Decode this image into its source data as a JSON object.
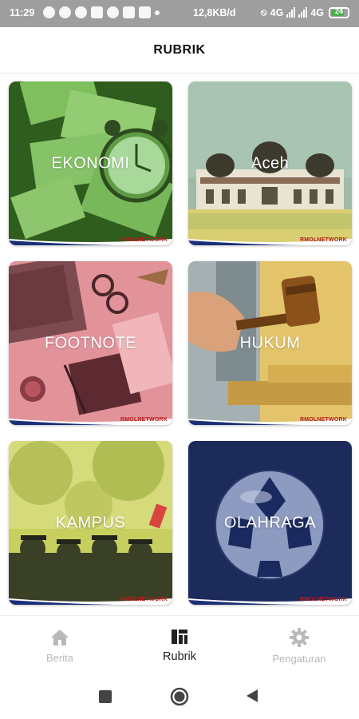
{
  "status_bar": {
    "time": "11:29",
    "network_speed": "12,8KB/d",
    "net_label_1": "4G",
    "net_label_2": "4G",
    "battery": "24"
  },
  "header": {
    "title": "RUBRIK"
  },
  "categories": [
    {
      "label": "EKONOMI",
      "brand": "RMOLNETWORK",
      "tint": "#7fbf5e"
    },
    {
      "label": "Aceh",
      "brand": "RMOLNETWORK",
      "tint": "#8fae9a"
    },
    {
      "label": "FOOTNOTE",
      "brand": "RMOLNETWORK",
      "tint": "#e89aa0"
    },
    {
      "label": "HUKUM",
      "brand": "RMOLNETWORK",
      "tint": "#e7c66a"
    },
    {
      "label": "KAMPUS",
      "brand": "RMOLNETWORK",
      "tint": "#b9c752"
    },
    {
      "label": "OLAHRAGA",
      "brand": "RMOLNETWORK",
      "tint": "#1f3269"
    }
  ],
  "bottom_nav": {
    "items": [
      {
        "label": "Berita",
        "icon": "home-icon"
      },
      {
        "label": "Rubrik",
        "icon": "grid-icon"
      },
      {
        "label": "Pengaturan",
        "icon": "gear-icon"
      }
    ],
    "active_index": 1
  },
  "colors": {
    "brand_red": "#b71c1c",
    "brand_navy": "#1a2f78",
    "inactive": "#b9b9b9"
  }
}
